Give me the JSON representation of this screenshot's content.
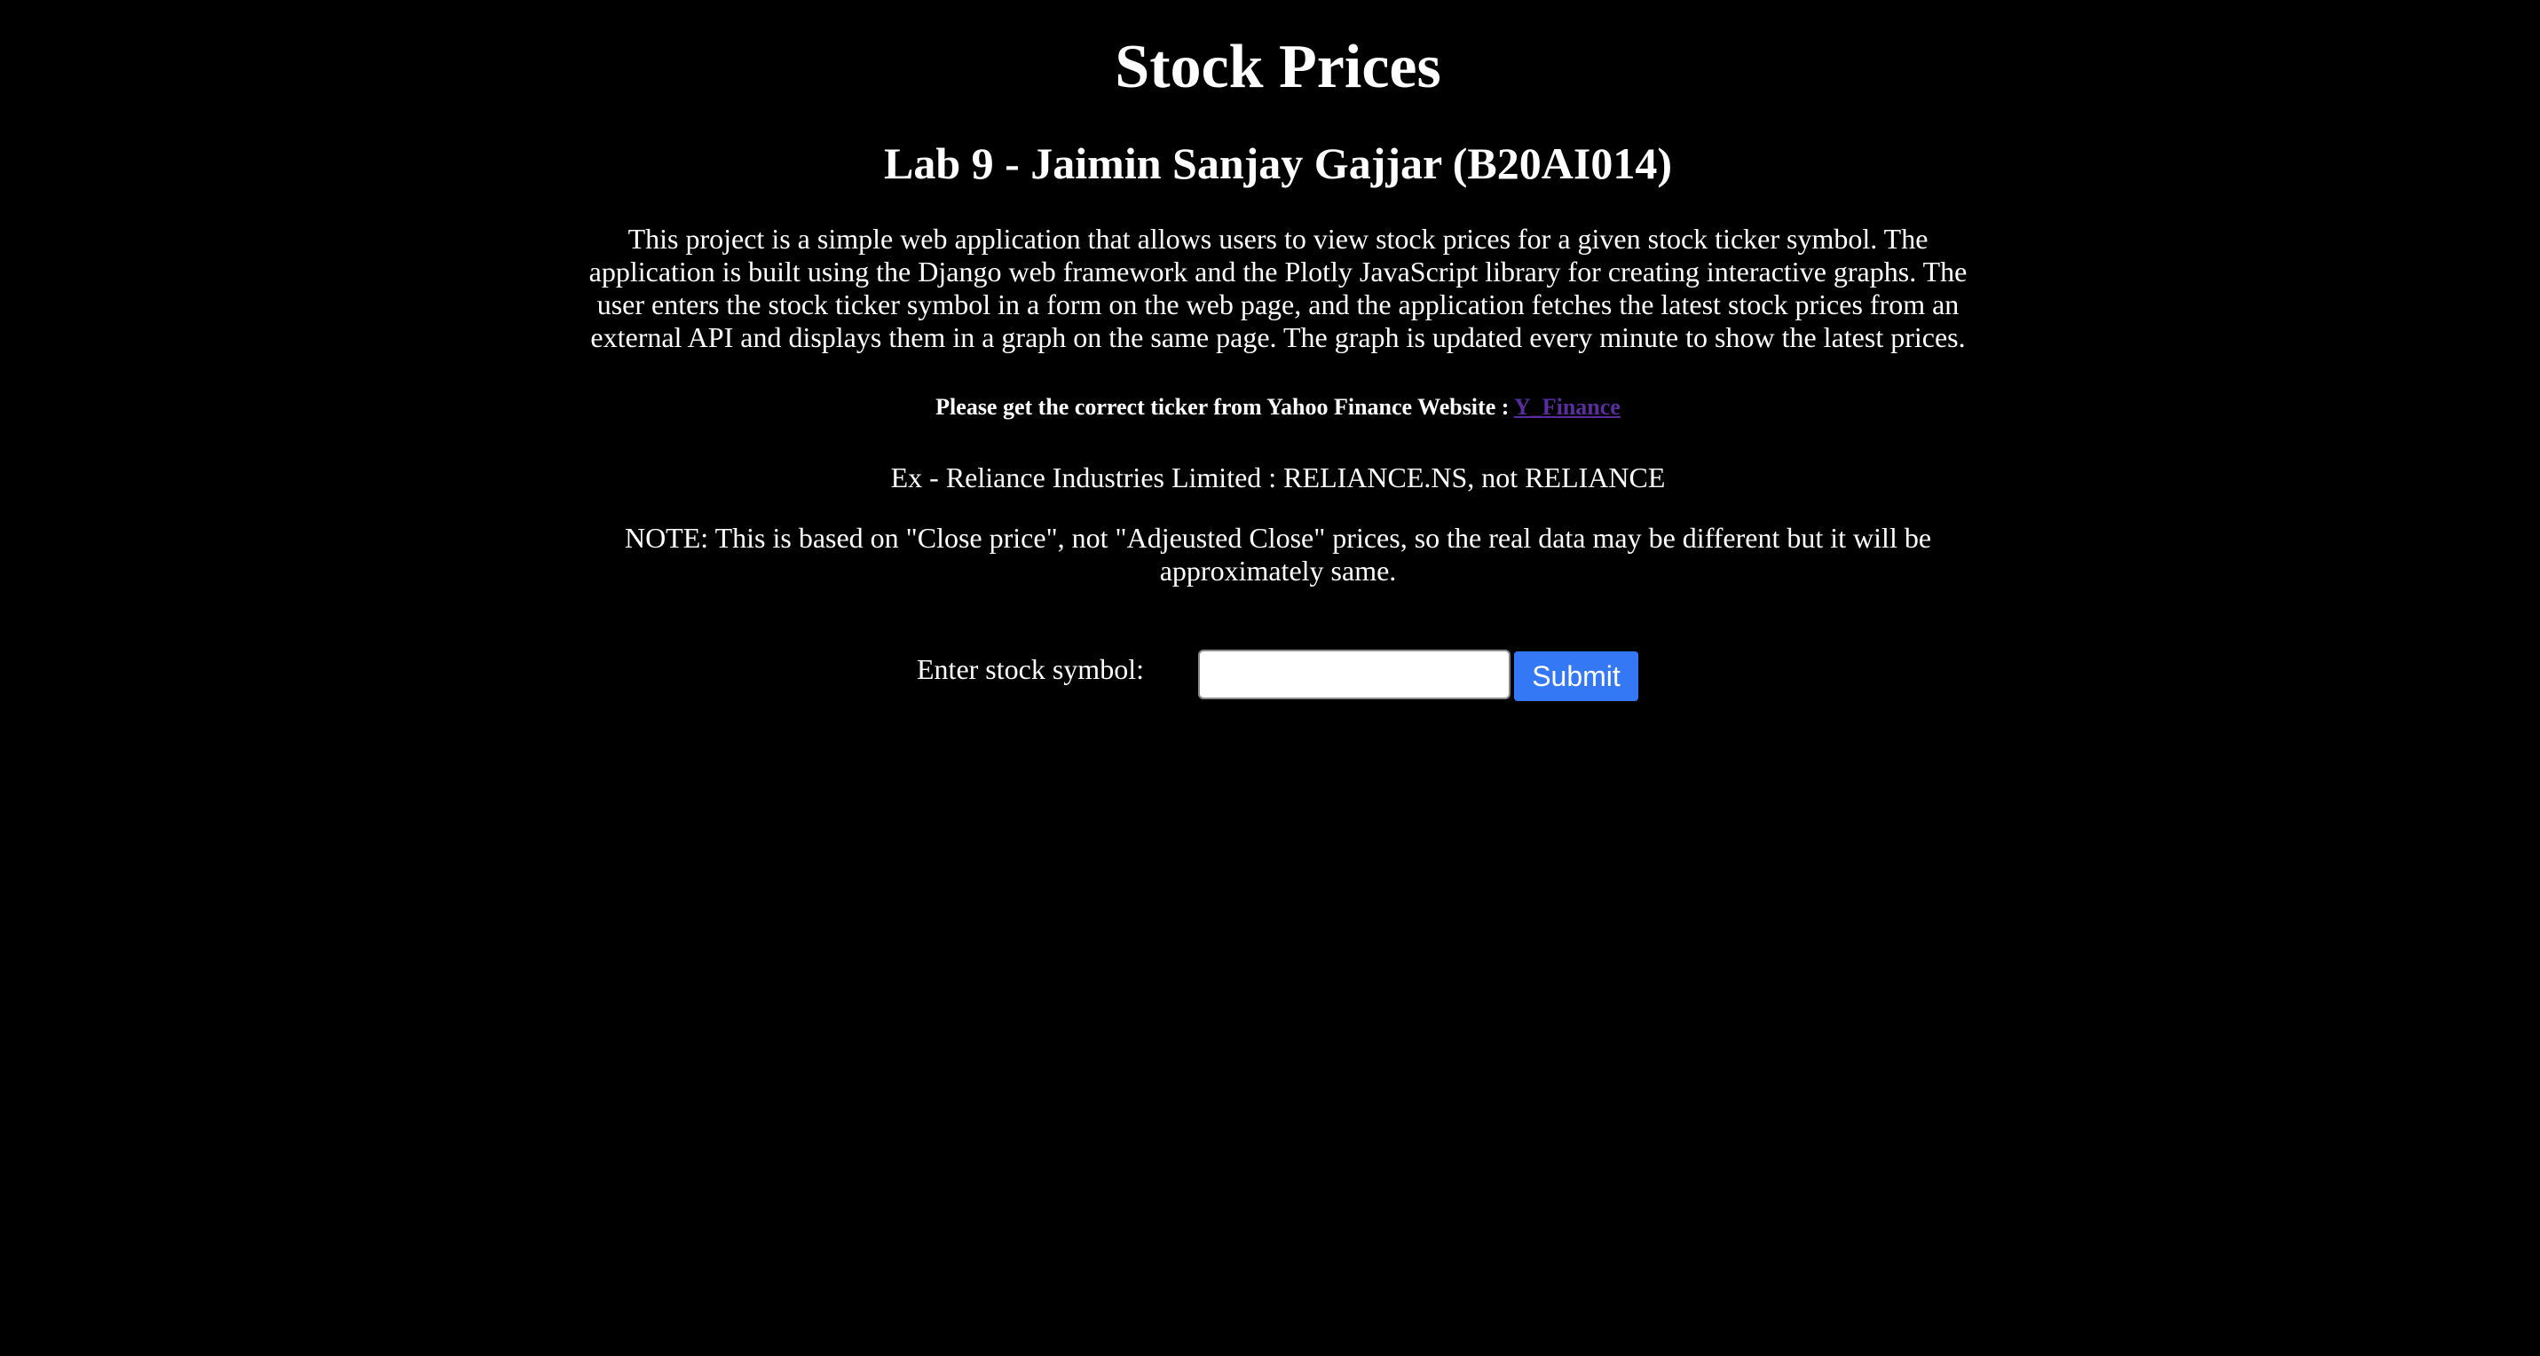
{
  "page": {
    "title": "Stock Prices",
    "subtitle": "Lab 9 - Jaimin Sanjay Gajjar (B20AI014)",
    "description": "This project is a simple web application that allows users to view stock prices for a given stock ticker symbol. The application is built using the Django web framework and the Plotly JavaScript library for creating interactive graphs. The user enters the stock ticker symbol in a form on the web page, and the application fetches the latest stock prices from an external API and displays them in a graph on the same page. The graph is updated every minute to show the latest prices.",
    "ticker_note": "Please get the correct ticker from Yahoo Finance Website : ",
    "ticker_link_label": "Y_Finance",
    "example": "Ex - Reliance Industries Limited : RELIANCE.NS, not RELIANCE",
    "note": "NOTE: This is based on \"Close price\", not \"Adjeusted Close\" prices, so the real data may be different but it will be approximately same."
  },
  "form": {
    "label": "Enter stock symbol:",
    "input_value": "",
    "submit_label": "Submit"
  },
  "colors": {
    "background": "#000000",
    "text": "#ffffff",
    "link": "#5a2d9e",
    "submit_button": "#3478f6"
  }
}
